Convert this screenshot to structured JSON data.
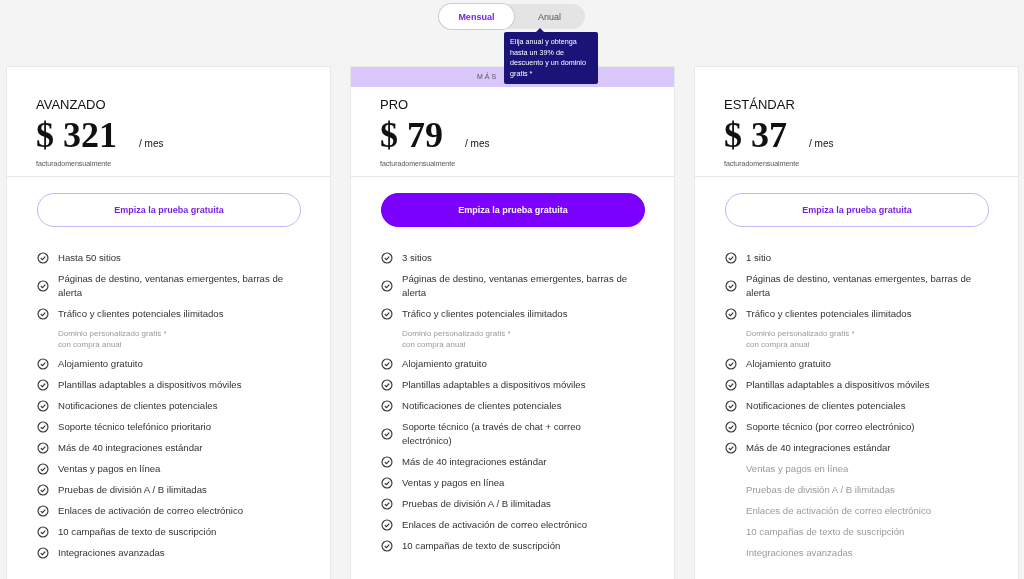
{
  "billing_toggle": [
    {
      "label": "Mensual",
      "selected": true
    },
    {
      "label": "Anual",
      "selected": false
    }
  ],
  "tooltip": {
    "text": "Elija anual y obtenga hasta un 39% de descuento y un dominio gratis *"
  },
  "plans": [
    {
      "name": "AVANZADO",
      "price": "$ 321",
      "period": "/ mes",
      "billing": "facturadomensualmente",
      "button": {
        "label": "Empiza la prueba gratuita",
        "primary": false
      },
      "features": [
        {
          "lines": [
            "Hasta 50 sitios"
          ],
          "included": true
        },
        {
          "lines": [
            "Páginas de destino, ventanas emergentes, barras de alerta"
          ],
          "included": true
        },
        {
          "lines": [
            "Tráfico y clientes potenciales ilimitados"
          ],
          "included": true
        },
        {
          "lines": [
            "Dominio personalizado gratis *",
            "con compra anual"
          ],
          "included": false,
          "kind": "note"
        },
        {
          "lines": [
            "Alojamiento gratuito"
          ],
          "included": true
        },
        {
          "lines": [
            "Plantillas adaptables a dispositivos móviles"
          ],
          "included": true
        },
        {
          "lines": [
            "Notificaciones de clientes potenciales"
          ],
          "included": true
        },
        {
          "lines": [
            "Soporte técnico telefónico prioritario"
          ],
          "included": true
        },
        {
          "lines": [
            "Más de 40 integraciones estándar"
          ],
          "included": true
        },
        {
          "lines": [
            "Ventas y pagos en línea"
          ],
          "included": true
        },
        {
          "lines": [
            "Pruebas de división A / B ilimitadas"
          ],
          "included": true
        },
        {
          "lines": [
            "Enlaces de activación de correo electrónico"
          ],
          "included": true
        },
        {
          "lines": [
            "10 campañas de texto de suscripción"
          ],
          "included": true
        },
        {
          "lines": [
            "Integraciones avanzadas"
          ],
          "included": true
        }
      ]
    },
    {
      "banner": "MÁS",
      "name": "PRO",
      "price": "$ 79",
      "period": "/ mes",
      "billing": "facturadomensualmente",
      "button": {
        "label": "Empiza la prueba gratuita",
        "primary": true
      },
      "features": [
        {
          "lines": [
            "3 sitios"
          ],
          "included": true
        },
        {
          "lines": [
            "Páginas de destino, ventanas emergentes, barras de alerta"
          ],
          "included": true
        },
        {
          "lines": [
            "Tráfico y clientes potenciales ilimitados"
          ],
          "included": true
        },
        {
          "lines": [
            "Dominio personalizado gratis *",
            "con compra anual"
          ],
          "included": false,
          "kind": "note"
        },
        {
          "lines": [
            "Alojamiento gratuito"
          ],
          "included": true
        },
        {
          "lines": [
            "Plantillas adaptables a dispositivos móviles"
          ],
          "included": true
        },
        {
          "lines": [
            "Notificaciones de clientes potenciales"
          ],
          "included": true
        },
        {
          "lines": [
            "Soporte técnico (a través de chat + correo electrónico)"
          ],
          "included": true
        },
        {
          "lines": [
            "Más de 40 integraciones estándar"
          ],
          "included": true
        },
        {
          "lines": [
            "Ventas y pagos en línea"
          ],
          "included": true
        },
        {
          "lines": [
            "Pruebas de división A / B ilimitadas"
          ],
          "included": true
        },
        {
          "lines": [
            "Enlaces de activación de correo electrónico"
          ],
          "included": true
        },
        {
          "lines": [
            "10 campañas de texto de suscripción"
          ],
          "included": true
        }
      ]
    },
    {
      "name": "ESTÁNDAR",
      "price": "$ 37",
      "period": "/ mes",
      "billing": "facturadomensualmente",
      "button": {
        "label": "Empiza la prueba gratuita",
        "primary": false
      },
      "features": [
        {
          "lines": [
            "1 sitio"
          ],
          "included": true
        },
        {
          "lines": [
            "Páginas de destino, ventanas emergentes, barras de alerta"
          ],
          "included": true
        },
        {
          "lines": [
            "Tráfico y clientes potenciales ilimitados"
          ],
          "included": true
        },
        {
          "lines": [
            "Dominio personalizado gratis *",
            "con compra anual"
          ],
          "included": false,
          "kind": "note"
        },
        {
          "lines": [
            "Alojamiento gratuito"
          ],
          "included": true
        },
        {
          "lines": [
            "Plantillas adaptables a dispositivos móviles"
          ],
          "included": true
        },
        {
          "lines": [
            "Notificaciones de clientes potenciales"
          ],
          "included": true
        },
        {
          "lines": [
            "Soporte técnico (por correo electrónico)"
          ],
          "included": true
        },
        {
          "lines": [
            "Más de 40 integraciones estándar"
          ],
          "included": true
        },
        {
          "lines": [
            "Ventas y pagos en línea"
          ],
          "included": false
        },
        {
          "lines": [
            "Pruebas de división A / B ilimitadas"
          ],
          "included": false
        },
        {
          "lines": [
            "Enlaces de activación de correo electrónico"
          ],
          "included": false
        },
        {
          "lines": [
            "10 campañas de texto de suscripción"
          ],
          "included": false
        },
        {
          "lines": [
            "Integraciones avanzadas"
          ],
          "included": false
        }
      ]
    }
  ]
}
